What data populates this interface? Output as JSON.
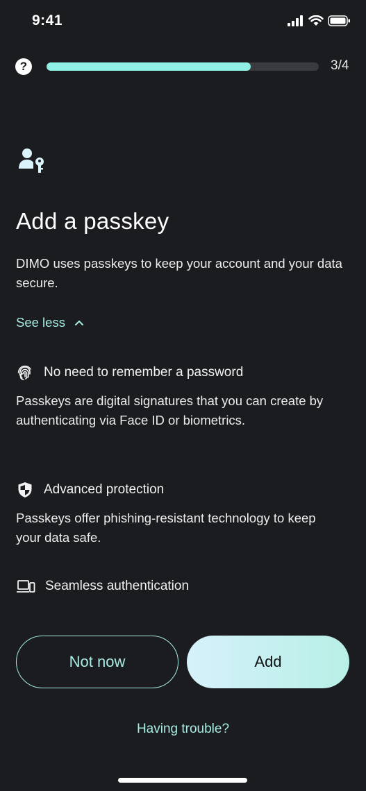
{
  "status_bar": {
    "time": "9:41"
  },
  "header": {
    "help_label": "?",
    "progress_fraction": 0.75,
    "step_text": "3/4"
  },
  "main": {
    "title": "Add a passkey",
    "description": "DIMO uses passkeys to keep your account and your data secure.",
    "toggle_label": "See less",
    "features": [
      {
        "icon": "fingerprint-icon",
        "heading": "No need to remember a password",
        "body": "Passkeys are digital signatures that you can create by authenticating via Face ID or biometrics."
      },
      {
        "icon": "shield-icon",
        "heading": "Advanced protection",
        "body": "Passkeys offer phishing-resistant technology to keep your data safe."
      },
      {
        "icon": "devices-icon",
        "heading": "Seamless authentication",
        "body": ""
      }
    ]
  },
  "actions": {
    "secondary_label": "Not now",
    "primary_label": "Add",
    "help_link": "Having trouble?"
  },
  "colors": {
    "background": "#1b1c1f",
    "accent": "#8ff0e6",
    "link": "#a8ece4"
  }
}
